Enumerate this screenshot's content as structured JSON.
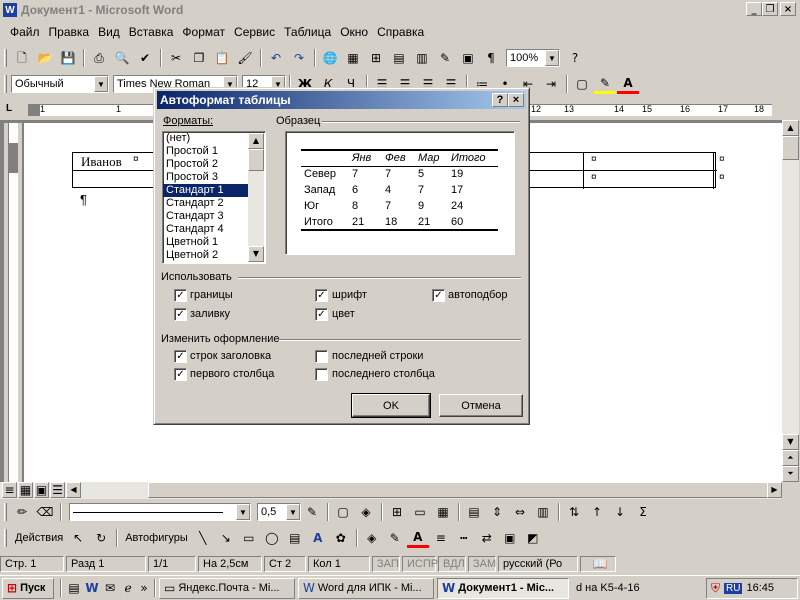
{
  "window": {
    "title": "Документ1 - Microsoft Word",
    "app_icon_letter": "W",
    "controls": [
      "_",
      "❐",
      "×"
    ]
  },
  "menu": [
    "Файл",
    "Правка",
    "Вид",
    "Вставка",
    "Формат",
    "Сервис",
    "Таблица",
    "Окно",
    "Справка"
  ],
  "standard_toolbar": {
    "zoom": "100%"
  },
  "format_toolbar": {
    "style": "Обычный",
    "font": "Times New Roman",
    "size": "12",
    "bold": "Ж",
    "italic": "К",
    "underline": "Ч"
  },
  "ruler_marks": [
    "1",
    "1",
    "12",
    "13",
    "14",
    "15",
    "16",
    "17",
    "18"
  ],
  "document": {
    "cell_text": "Иванов",
    "cell_marker": "¤",
    "paragraph_mark": "¶"
  },
  "dialog": {
    "title": "Автоформат таблицы",
    "help": "?",
    "close": "×",
    "formats_label": "Форматы:",
    "formats": [
      "(нет)",
      "Простой 1",
      "Простой 2",
      "Простой 3",
      "Стандарт 1",
      "Стандарт 2",
      "Стандарт 3",
      "Стандарт 4",
      "Цветной 1",
      "Цветной 2"
    ],
    "selected_format": "Стандарт 1",
    "preview_label": "Образец",
    "preview_table": {
      "headers": [
        "",
        "Янв",
        "Фев",
        "Мар",
        "Итого"
      ],
      "rows": [
        [
          "Север",
          "7",
          "7",
          "5",
          "19"
        ],
        [
          "Запад",
          "6",
          "4",
          "7",
          "17"
        ],
        [
          "Юг",
          "8",
          "7",
          "9",
          "24"
        ],
        [
          "Итого",
          "21",
          "18",
          "21",
          "60"
        ]
      ]
    },
    "use_label": "Использовать",
    "use": {
      "borders": {
        "label": "границы",
        "checked": true
      },
      "font": {
        "label": "шрифт",
        "checked": true
      },
      "autofit": {
        "label": "автоподбор",
        "checked": true
      },
      "shading": {
        "label": "заливку",
        "checked": true
      },
      "color": {
        "label": "цвет",
        "checked": true
      }
    },
    "apply_label": "Изменить оформление",
    "apply": {
      "header_rows": {
        "label": "строк заголовка",
        "checked": true
      },
      "last_row": {
        "label": "последней строки",
        "checked": false
      },
      "first_column": {
        "label": "первого столбца",
        "checked": true
      },
      "last_column": {
        "label": "последнего столбца",
        "checked": false
      }
    },
    "ok": "OK",
    "cancel": "Отмена",
    "check_glyph": "✓"
  },
  "drawing_toolbar": {
    "line_width": "0,5",
    "actions": "Действия",
    "autoshapes": "Автофигуры"
  },
  "status": {
    "page": "Стр.  1",
    "section": "Разд  1",
    "pages": "1/1",
    "at": "На 2,5см",
    "line": "Ст  2",
    "col": "Кол  1",
    "rec": "ЗАП",
    "trk": "ИСПР",
    "ext": "ВДЛ",
    "ovr": "ЗАМ",
    "language": "русский (Ро"
  },
  "taskbar": {
    "start": "Пуск",
    "tasks": [
      "Яндекс.Почта - Mi...",
      "Word для ИПК - Mi...",
      "Документ1 - Mic..."
    ],
    "overflow": "d на K5-4-16",
    "lang": "RU",
    "time": "16:45"
  }
}
